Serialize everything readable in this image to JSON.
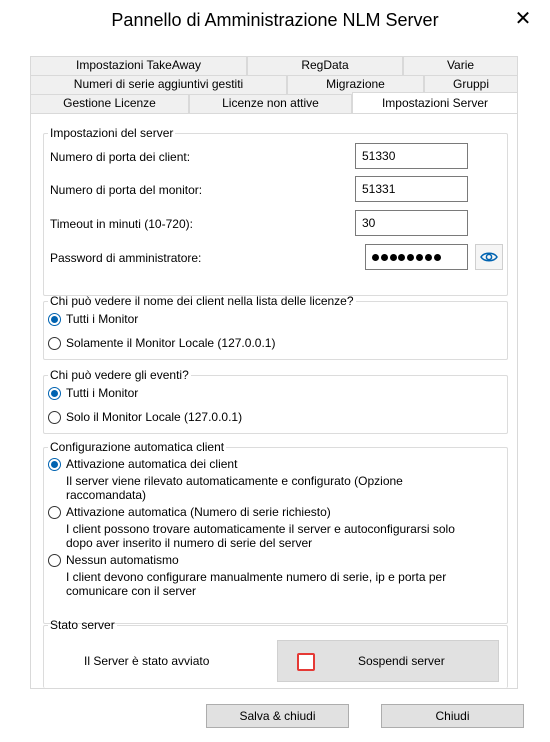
{
  "window": {
    "title": "Pannello di Amministrazione NLM Server",
    "close_glyph": "✕"
  },
  "tabs": {
    "row1": [
      "Impostazioni TakeAway",
      "RegData",
      "Varie"
    ],
    "row2": [
      "Numeri di serie aggiuntivi gestiti",
      "Migrazione",
      "Gruppi"
    ],
    "row3": [
      "Gestione Licenze",
      "Licenze non attive",
      "Impostazioni Server"
    ],
    "active": "Impostazioni Server"
  },
  "server_settings": {
    "legend": "Impostazioni del server",
    "client_port_label": "Numero di porta dei client:",
    "client_port_value": "51330",
    "monitor_port_label": "Numero di porta del monitor:",
    "monitor_port_value": "51331",
    "timeout_label": "Timeout in minuti (10-720):",
    "timeout_value": "30",
    "password_label": "Password di amministratore:",
    "password_dots": 8,
    "eye_icon": "eye-icon"
  },
  "client_visibility": {
    "legend": "Chi può vedere il nome dei client nella lista delle licenze?",
    "opt1": "Tutti i Monitor",
    "opt2": "Solamente il Monitor Locale (127.0.0.1)",
    "selected": 1
  },
  "events_visibility": {
    "legend": "Chi può vedere gli eventi?",
    "opt1": "Tutti i Monitor",
    "opt2": "Solo il Monitor Locale (127.0.0.1)",
    "selected": 1
  },
  "auto_config": {
    "legend": "Configurazione automatica client",
    "opt1": "Attivazione automatica dei client",
    "opt1_desc1": "Il server viene rilevato automaticamente e configurato (Opzione",
    "opt1_desc2": "raccomandata)",
    "opt2": "Attivazione automatica (Numero di serie richiesto)",
    "opt2_desc1": "I client possono trovare automaticamente il server e autoconfigurarsi solo",
    "opt2_desc2": "dopo aver inserito il numero di serie del server",
    "opt3": "Nessun automatismo",
    "opt3_desc1": "I client devono configurare manualmente numero di serie, ip e porta per",
    "opt3_desc2": "comunicare con il server",
    "selected": 1
  },
  "server_status": {
    "legend": "Stato server",
    "status_text": "Il Server è stato avviato",
    "suspend_label": "Sospendi server",
    "stop_color": "#e53935"
  },
  "buttons": {
    "save_close": "Salva & chiudi",
    "close": "Chiudi"
  },
  "colors": {
    "accent": "#0063b1",
    "button_bg": "#e1e1e1"
  }
}
